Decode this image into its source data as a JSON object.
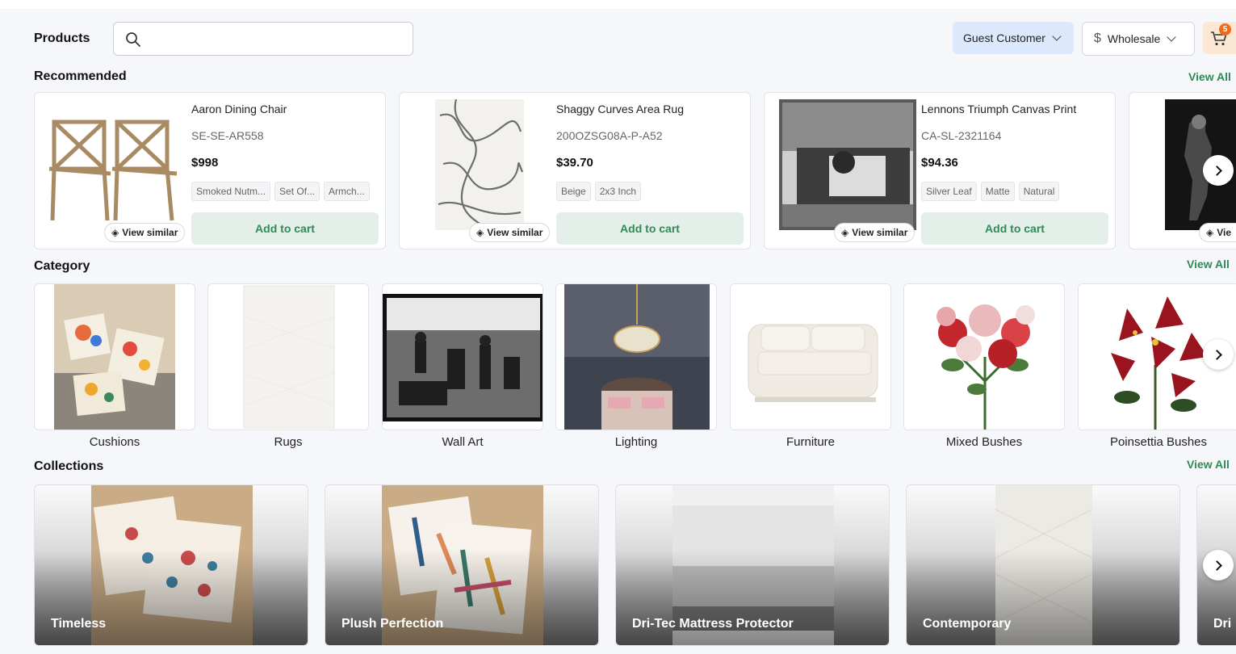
{
  "header": {
    "title": "Products",
    "search_placeholder": "",
    "customer": "Guest Customer",
    "price_mode": "Wholesale",
    "cart_count": "5"
  },
  "recommended": {
    "title": "Recommended",
    "view_all": "View All",
    "view_similar": "View similar",
    "add_to_cart": "Add to cart",
    "items": [
      {
        "name": "Aaron Dining Chair",
        "sku": "SE-SE-AR558",
        "price": "$998",
        "tags": [
          "Smoked Nutm...",
          "Set Of...",
          "Armch..."
        ]
      },
      {
        "name": "Shaggy Curves Area Rug",
        "sku": "200OZSG08A-P-A52",
        "price": "$39.70",
        "tags": [
          "Beige",
          "2x3 Inch"
        ]
      },
      {
        "name": "Lennons Triumph Canvas Print",
        "sku": "CA-SL-2321164",
        "price": "$94.36",
        "tags": [
          "Silver Leaf",
          "Matte",
          "Natural"
        ]
      },
      {
        "view_similar_partial": "Vie"
      }
    ]
  },
  "category": {
    "title": "Category",
    "view_all": "View All",
    "items": [
      "Cushions",
      "Rugs",
      "Wall Art",
      "Lighting",
      "Furniture",
      "Mixed Bushes",
      "Poinsettia Bushes"
    ]
  },
  "collections": {
    "title": "Collections",
    "view_all": "View All",
    "items": [
      "Timeless",
      "Plush Perfection",
      "Dri-Tec Mattress Protector",
      "Contemporary",
      "Dri"
    ]
  },
  "colors": {
    "accent_green": "#2e8b57",
    "guest_bg": "#dce8fb",
    "cart_bg": "#fbe7d2",
    "badge": "#f06a1a"
  }
}
